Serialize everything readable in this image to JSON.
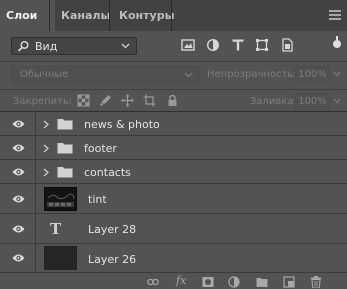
{
  "tabs": [
    {
      "label": "Слои",
      "active": true
    },
    {
      "label": "Каналы",
      "active": false
    },
    {
      "label": "Контуры",
      "active": false
    }
  ],
  "filter": {
    "kind_label": "Вид",
    "icons": [
      "pixel-filter-icon",
      "adjustment-filter-icon",
      "type-filter-icon",
      "shape-filter-icon",
      "smart-object-filter-icon"
    ]
  },
  "blend": {
    "mode": "Обычные",
    "opacity_label": "Непрозрачность:",
    "opacity_value": "100%"
  },
  "lock": {
    "label": "Закрепить:",
    "icons": [
      "lock-transparency-icon",
      "lock-pixels-icon",
      "lock-position-icon",
      "lock-artboard-icon",
      "lock-all-icon"
    ],
    "fill_label": "Заливка:",
    "fill_value": "100%"
  },
  "layers": [
    {
      "name": "news & photo",
      "type": "group"
    },
    {
      "name": "footer",
      "type": "group"
    },
    {
      "name": "contacts",
      "type": "group"
    },
    {
      "name": "tint",
      "type": "image"
    },
    {
      "name": "Layer 28",
      "type": "text",
      "glyph": "T"
    },
    {
      "name": "Layer 26",
      "type": "fill"
    }
  ],
  "bottom_toolbar": [
    "link-icon",
    "fx-icon",
    "mask-icon",
    "adjustment-icon",
    "group-icon",
    "new-layer-icon",
    "trash-icon"
  ],
  "bottom_fx_label": "fx",
  "colors": {
    "panel": "#535353",
    "tabbar": "#424242",
    "text": "#e4e4e4",
    "dimmed": "#7c7c7c"
  }
}
